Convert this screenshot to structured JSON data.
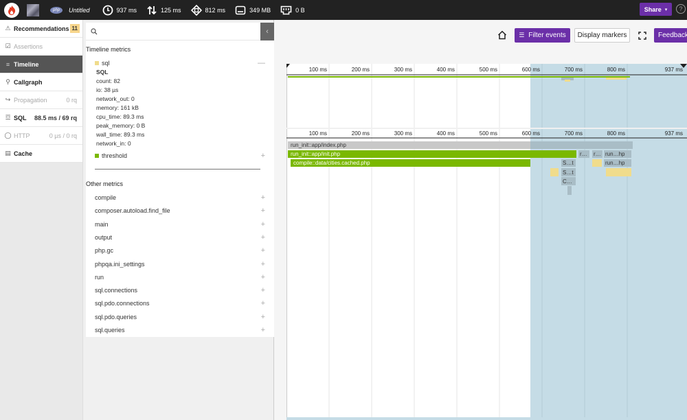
{
  "topbar": {
    "untitled": "Untitled",
    "php_badge": "php",
    "metrics": [
      {
        "icon": "clock-icon",
        "value": "937 ms"
      },
      {
        "icon": "io-arrows-icon",
        "value": "125 ms"
      },
      {
        "icon": "cpu-icon",
        "value": "812 ms"
      },
      {
        "icon": "memory-icon",
        "value": "349 MB"
      },
      {
        "icon": "network-icon",
        "value": "0 B"
      }
    ],
    "share_label": "Share",
    "help_label": "?"
  },
  "sidebar": {
    "items": [
      {
        "label": "Recommendations",
        "count": "11",
        "icon": "warning-circle-icon"
      },
      {
        "label": "Assertions",
        "icon": "check-circle-icon"
      },
      {
        "label": "Timeline",
        "icon": "timeline-icon"
      },
      {
        "label": "Callgraph",
        "icon": "callgraph-icon"
      },
      {
        "label": "Propagation",
        "value": "0 rq",
        "icon": "propagation-icon"
      },
      {
        "label": "SQL",
        "value": "88.5 ms / 69 rq",
        "icon": "database-icon"
      },
      {
        "label": "HTTP",
        "value": "0 µs / 0 rq",
        "icon": "globe-icon"
      },
      {
        "label": "Cache",
        "icon": "cache-icon"
      }
    ]
  },
  "panel": {
    "timeline_title": "Timeline metrics",
    "sql_label": "sql",
    "sql_details": [
      "SQL",
      "count: 82",
      "io: 38 µs",
      "network_out: 0",
      "memory: 161 kB",
      "cpu_time: 89.3 ms",
      "peak_memory: 0 B",
      "wall_time: 89.3 ms",
      "network_in: 0"
    ],
    "threshold_label": "threshold",
    "other_title": "Other metrics",
    "other_metrics": [
      "compile",
      "composer.autoload.find_file",
      "main",
      "output",
      "php.gc",
      "phpqa.ini_settings",
      "run",
      "sql.connections",
      "sql.pdo.connections",
      "sql.pdo.queries",
      "sql.queries"
    ]
  },
  "toolbar": {
    "filter_label": "Filter events",
    "markers_label": "Display markers",
    "feedback_label": "Feedback"
  },
  "timeline": {
    "ticks": [
      "100 ms",
      "200 ms",
      "300 ms",
      "400 ms",
      "500 ms",
      "600 ms",
      "700 ms",
      "800 ms",
      "937 ms"
    ],
    "bars": {
      "index": "run_init::app/index.php",
      "init": "run_init::app/init.php",
      "compile": "compile::data/cities.cached.php",
      "r1": "r…",
      "r2": "r…",
      "runhp1": "run…hp",
      "runhp2": "run…hp",
      "st1": "S…t",
      "st2": "S…t",
      "c1": "C…"
    }
  },
  "colors": {
    "green": "#7ab800",
    "accent": "#6b2fa8",
    "highlight": "#c5dce6",
    "sql_yellow": "#f0dc8c",
    "topbar": "#222222"
  }
}
